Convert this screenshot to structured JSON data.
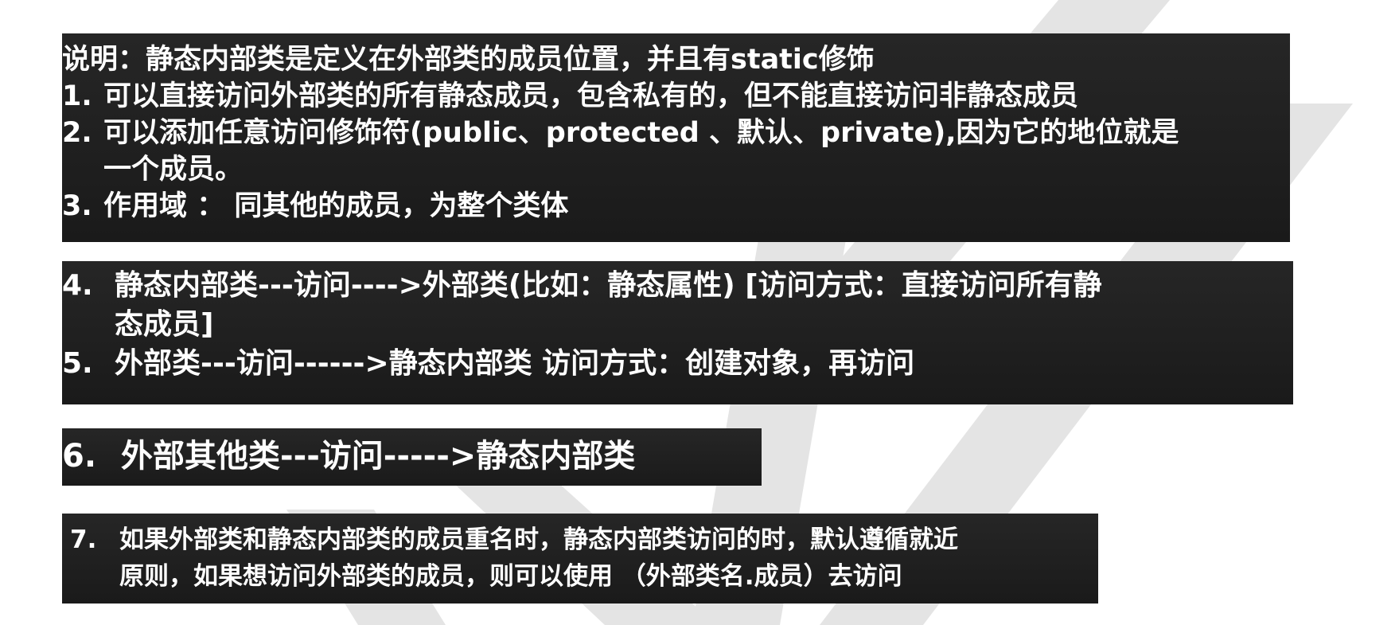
{
  "panel1": {
    "title": "说明：静态内部类是定义在外部类的成员位置，并且有static修饰",
    "items": [
      {
        "num": "1.",
        "lines": [
          "可以直接访问外部类的所有静态成员，包含私有的，但不能直接访问非静态成员"
        ]
      },
      {
        "num": "2.",
        "lines": [
          "可以添加任意访问修饰符(public、protected 、默认、private),因为它的地位就是",
          "一个成员。"
        ]
      },
      {
        "num": "3.",
        "lines": [
          "作用域 ： 同其他的成员，为整个类体"
        ]
      }
    ]
  },
  "panel2": {
    "items": [
      {
        "num": "4.",
        "lines": [
          "静态内部类---访问---->外部类(比如：静态属性) [访问方式：直接访问所有静",
          "态成员]"
        ]
      },
      {
        "num": "5.",
        "lines": [
          "外部类---访问------>静态内部类 访问方式：创建对象，再访问"
        ]
      }
    ]
  },
  "panel3": {
    "items": [
      {
        "num": "6.",
        "lines": [
          "外部其他类---访问----->静态内部类"
        ]
      }
    ]
  },
  "panel4": {
    "items": [
      {
        "num": "7.",
        "lines": [
          "如果外部类和静态内部类的成员重名时，静态内部类访问的时，默认遵循就近",
          "原则，如果想访问外部类的成员，则可以使用 （外部类名.成员）去访问"
        ]
      }
    ]
  },
  "colors": {
    "panel_bg": "#222222",
    "text": "#ffffff",
    "watermark": "#e6e6e6"
  }
}
